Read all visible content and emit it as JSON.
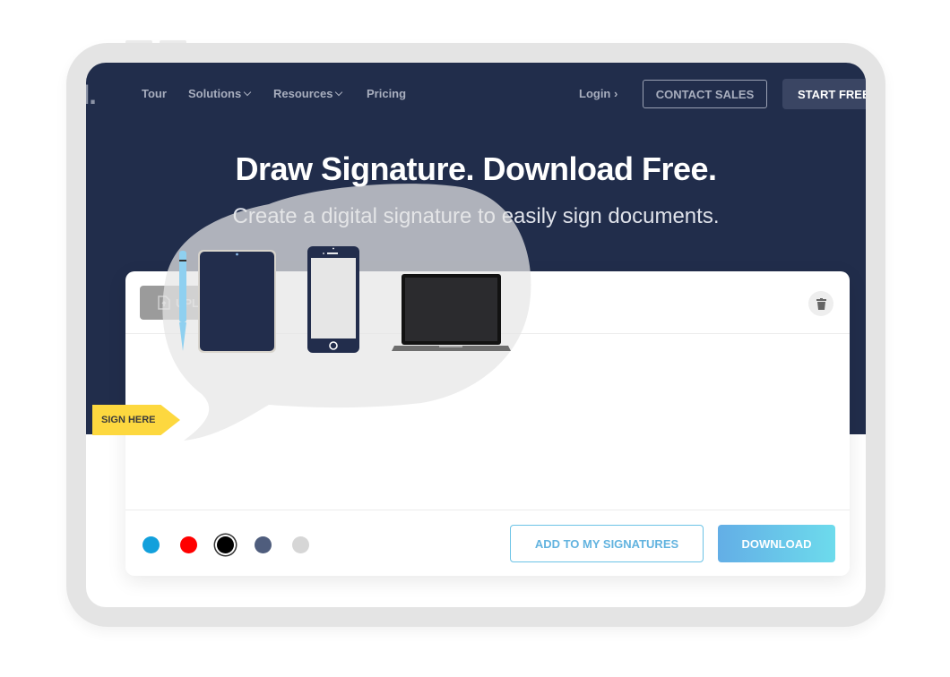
{
  "nav": {
    "logo": "l.",
    "items": [
      {
        "label": "Tour",
        "has_dropdown": false
      },
      {
        "label": "Solutions",
        "has_dropdown": true
      },
      {
        "label": "Resources",
        "has_dropdown": true
      },
      {
        "label": "Pricing",
        "has_dropdown": false
      }
    ],
    "login": "Login ›",
    "contact_sales": "CONTACT SALES",
    "start_free": "START FREE"
  },
  "hero": {
    "title": "Draw Signature. Download Free.",
    "subtitle": "Create a digital signature to easily sign documents."
  },
  "card": {
    "upload_label": "UPL",
    "upload_icon": "file-upload-icon",
    "trash_icon": "trash-icon",
    "sign_here": "SIGN HERE",
    "colors": [
      {
        "name": "blue",
        "hex": "#12a0dc",
        "selected": false
      },
      {
        "name": "red",
        "hex": "#ff0000",
        "selected": false
      },
      {
        "name": "black",
        "hex": "#000000",
        "selected": true
      },
      {
        "name": "slate",
        "hex": "#4f5d7d",
        "selected": false
      },
      {
        "name": "light-gray",
        "hex": "#d6d6d6",
        "selected": false
      }
    ],
    "add_to_signatures": "ADD TO MY SIGNATURES",
    "download": "DOWNLOAD"
  },
  "overlay": {
    "devices": [
      "stylus-icon",
      "tablet-icon",
      "phone-icon",
      "laptop-icon"
    ]
  }
}
